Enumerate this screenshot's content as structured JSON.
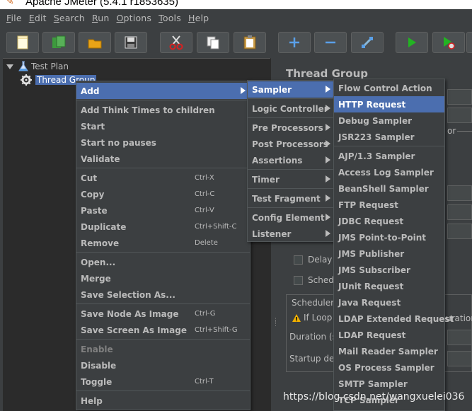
{
  "window": {
    "title": "Apache JMeter (5.4.1 r1853635)"
  },
  "menubar": [
    "File",
    "Edit",
    "Search",
    "Run",
    "Options",
    "Tools",
    "Help"
  ],
  "toolbar": [
    "new-icon",
    "templates-icon",
    "open-icon",
    "save-icon",
    "cut-icon",
    "copy-icon",
    "paste-icon",
    "expand-icon",
    "collapse-icon",
    "toggle-icon",
    "start-icon",
    "start-no-pauses-icon"
  ],
  "tree": {
    "root": "Test Plan",
    "child": "Thread Group"
  },
  "panel": {
    "title": "Thread Group",
    "partial_or": "or",
    "delay_label": "Delay T",
    "scheduler_label": "Sched",
    "scheduler_section": "Scheduler",
    "if_loop": "If Loop c",
    "duration_label": "Duration (s",
    "startup_label": "Startup del",
    "uration_tail": "uration"
  },
  "context_menu": [
    {
      "label": "Add",
      "submenu": true,
      "highlighted": true
    },
    {
      "sep": true
    },
    {
      "label": "Add Think Times to children"
    },
    {
      "label": "Start"
    },
    {
      "label": "Start no pauses"
    },
    {
      "label": "Validate"
    },
    {
      "sep": true
    },
    {
      "label": "Cut",
      "shortcut": "Ctrl-X"
    },
    {
      "label": "Copy",
      "shortcut": "Ctrl-C"
    },
    {
      "label": "Paste",
      "shortcut": "Ctrl-V"
    },
    {
      "label": "Duplicate",
      "shortcut": "Ctrl+Shift-C"
    },
    {
      "label": "Remove",
      "shortcut": "Delete"
    },
    {
      "sep": true
    },
    {
      "label": "Open..."
    },
    {
      "label": "Merge"
    },
    {
      "label": "Save Selection As..."
    },
    {
      "sep": true
    },
    {
      "label": "Save Node As Image",
      "shortcut": "Ctrl-G"
    },
    {
      "label": "Save Screen As Image",
      "shortcut": "Ctrl+Shift-G"
    },
    {
      "sep": true
    },
    {
      "label": "Enable",
      "disabled": true
    },
    {
      "label": "Disable"
    },
    {
      "label": "Toggle",
      "shortcut": "Ctrl-T"
    },
    {
      "sep": true
    },
    {
      "label": "Help"
    }
  ],
  "add_submenu": [
    {
      "label": "Sampler",
      "submenu": true,
      "highlighted": true
    },
    {
      "sep": true
    },
    {
      "label": "Logic Controller",
      "submenu": true
    },
    {
      "sep": true
    },
    {
      "label": "Pre Processors",
      "submenu": true
    },
    {
      "label": "Post Processors",
      "submenu": true
    },
    {
      "label": "Assertions",
      "submenu": true
    },
    {
      "sep": true
    },
    {
      "label": "Timer",
      "submenu": true
    },
    {
      "sep": true
    },
    {
      "label": "Test Fragment",
      "submenu": true
    },
    {
      "sep": true
    },
    {
      "label": "Config Element",
      "submenu": true
    },
    {
      "label": "Listener",
      "submenu": true
    }
  ],
  "sampler_submenu": [
    {
      "label": "Flow Control Action"
    },
    {
      "label": "HTTP Request",
      "highlighted": true
    },
    {
      "label": "Debug Sampler"
    },
    {
      "label": "JSR223 Sampler"
    },
    {
      "sep": true
    },
    {
      "label": "AJP/1.3 Sampler"
    },
    {
      "label": "Access Log Sampler"
    },
    {
      "label": "BeanShell Sampler"
    },
    {
      "label": "FTP Request"
    },
    {
      "label": "JDBC Request"
    },
    {
      "label": "JMS Point-to-Point"
    },
    {
      "label": "JMS Publisher"
    },
    {
      "label": "JMS Subscriber"
    },
    {
      "label": "JUnit Request"
    },
    {
      "label": "Java Request"
    },
    {
      "label": "LDAP Extended Request"
    },
    {
      "label": "LDAP Request"
    },
    {
      "label": "Mail Reader Sampler"
    },
    {
      "label": "OS Process Sampler"
    },
    {
      "label": "SMTP Sampler"
    },
    {
      "label": "TCP Sampler"
    }
  ],
  "watermark": "https://blog.csdn.net/wangxuelei036",
  "colors": {
    "background": "#3c3f41",
    "tree_background": "#2b2b2b",
    "selection": "#4b6eaf",
    "text": "#bbbbbb"
  }
}
